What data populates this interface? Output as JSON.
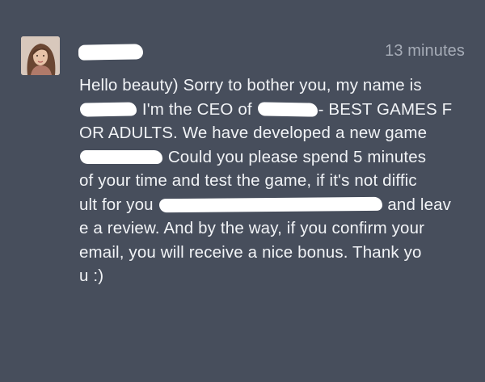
{
  "message": {
    "timestamp": "13 minutes",
    "segments": {
      "l1": "Hello beauty) Sorry to bother you, my name is",
      "l2a": " I'm the CEO of ",
      "l2b": "- BEST GAMES F",
      "l3": "OR ADULTS. We have developed a new game",
      "l4": " Could you please spend 5 minutes",
      "l5": "of your time and test the game, if it's not diffic",
      "l6a": "ult for you ",
      "l6b": " and leav",
      "l7": "e a review. And by the way, if you confirm your",
      "l8": " email, you will receive a nice bonus. Thank yo",
      "l9": "u :)"
    }
  }
}
